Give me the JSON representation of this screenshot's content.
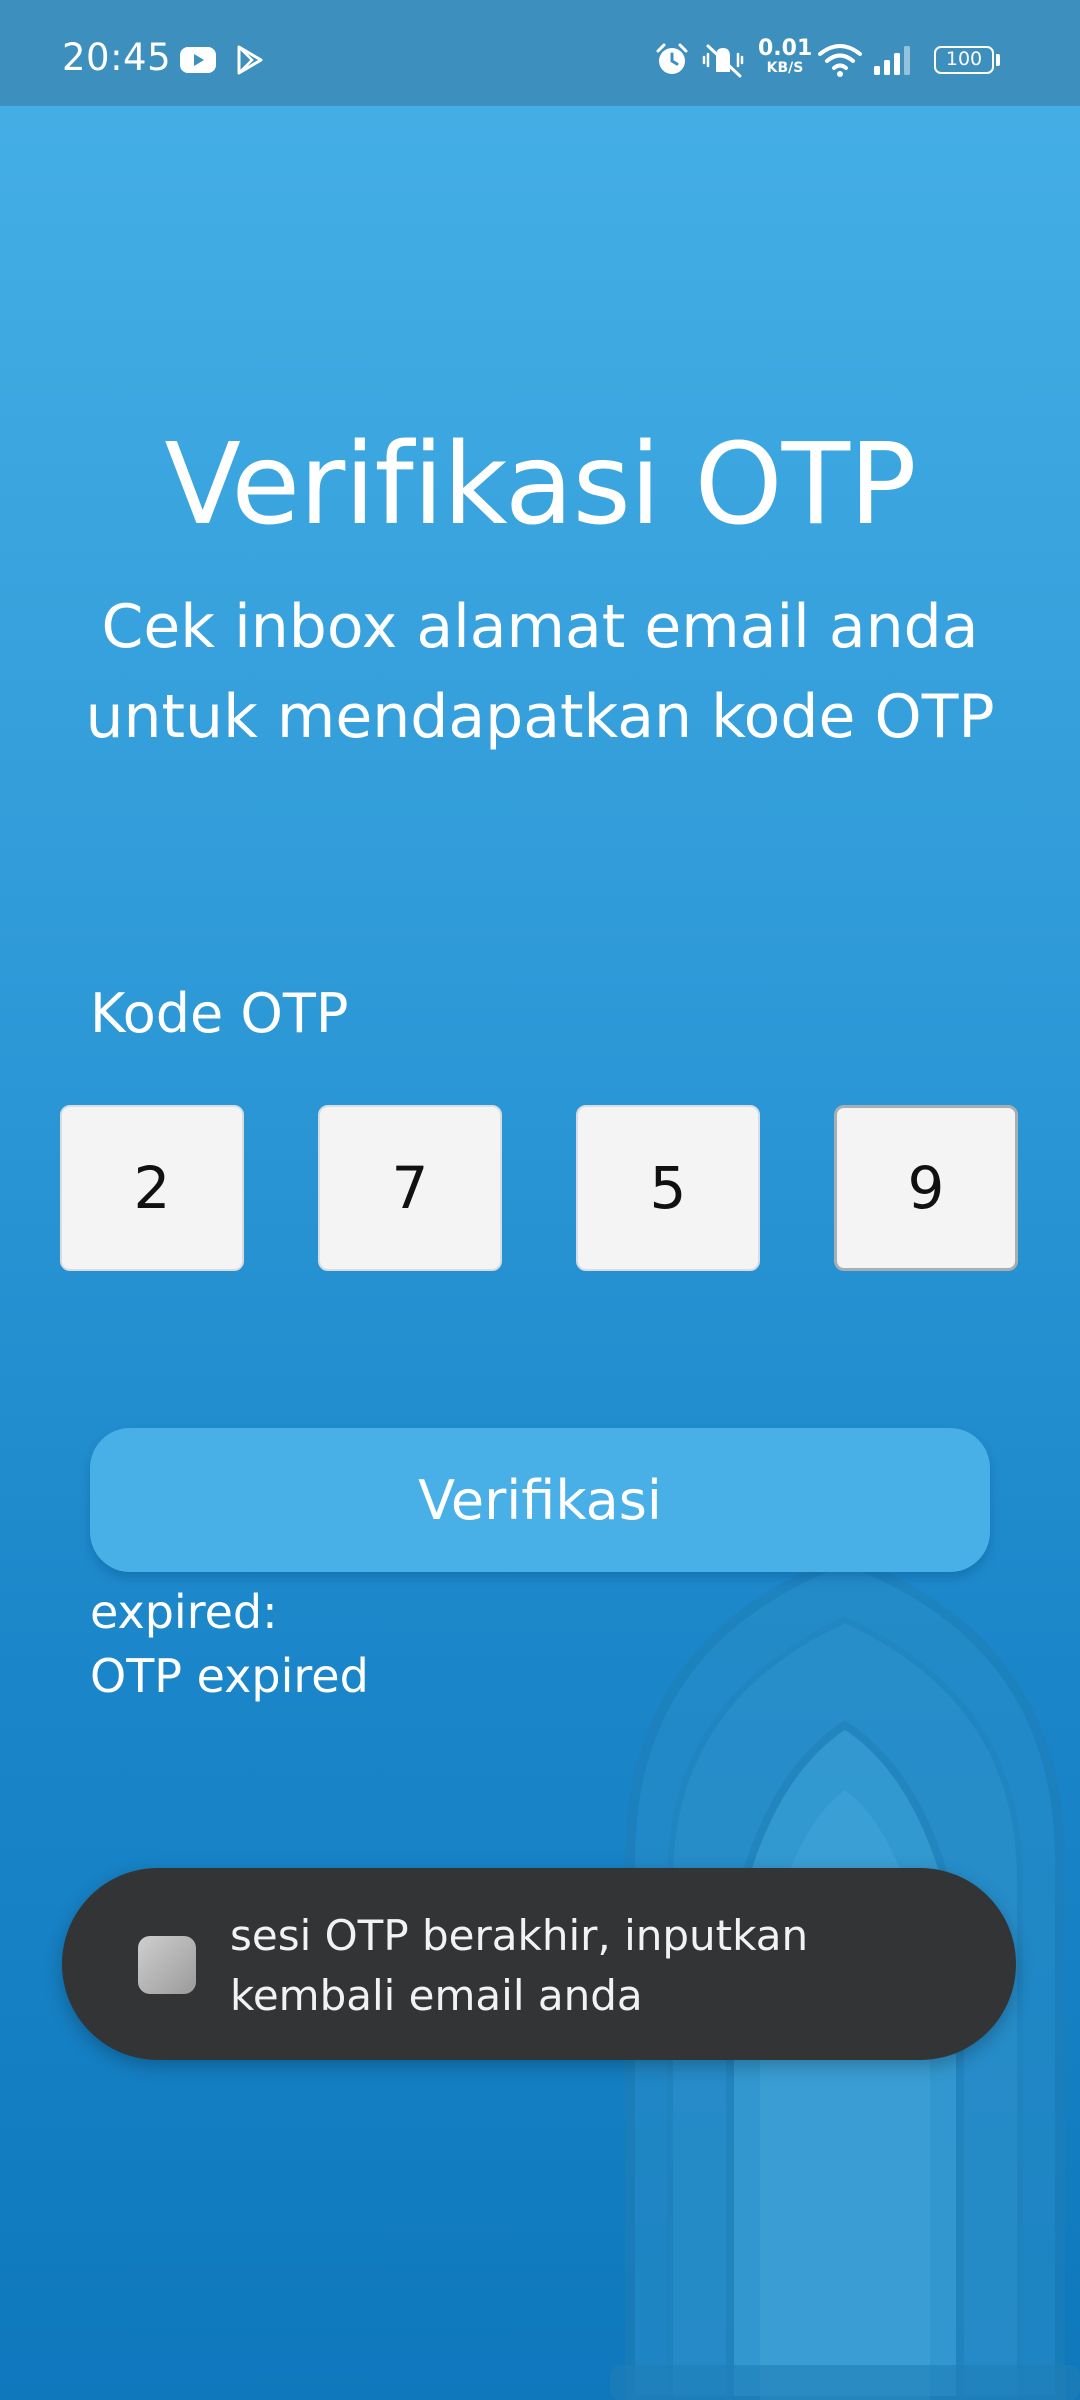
{
  "status_bar": {
    "time": "20:45",
    "net_speed": "0.01",
    "net_unit": "KB/S",
    "battery": "100",
    "icons": [
      "youtube-icon",
      "play-store-icon",
      "alarm-icon",
      "mute-vibrate-icon",
      "wifi-icon",
      "signal-icon",
      "battery-icon"
    ]
  },
  "header": {
    "title": "Verifikasi OTP",
    "subtitle": "Cek inbox alamat email anda untuk mendapatkan kode OTP"
  },
  "form": {
    "otp_label": "Kode OTP",
    "otp_digits": [
      "2",
      "7",
      "5",
      "9"
    ],
    "verify_button": "Verifikasi"
  },
  "status": {
    "line1": "expired:",
    "line2": "OTP expired"
  },
  "toast": {
    "message": "sesi OTP berakhir, inputkan kembali email anda",
    "icon": "app-icon"
  },
  "colors": {
    "background_top": "#46b0e6",
    "background_bottom": "#0f78bd",
    "button": "#48b0e6",
    "toast": "#323436"
  }
}
